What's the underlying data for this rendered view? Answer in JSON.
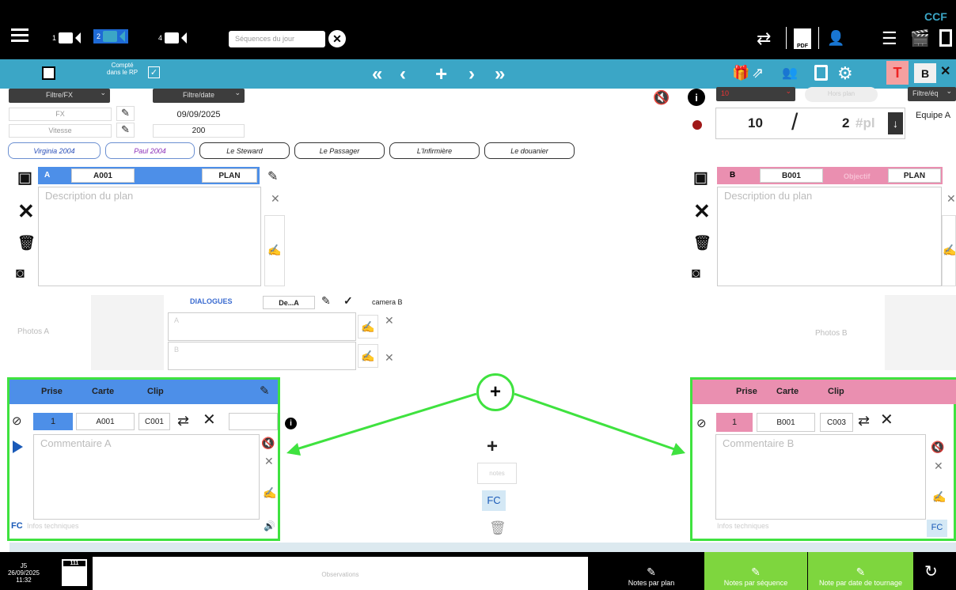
{
  "top": {
    "search_placeholder": "Séquences du jour",
    "brand": "CCF",
    "cams": [
      "1",
      "2",
      "4"
    ]
  },
  "bar": {
    "counted_label_1": "Compté",
    "counted_label_2": "dans le RP"
  },
  "filters": {
    "fx": "Filtre/FX",
    "date": "Filtre/date",
    "fx_input": "FX",
    "date_value": "09/09/2025",
    "speed": "Vitesse",
    "speed_value": "200",
    "sel10": "10",
    "hors_plan": "Hors plan",
    "filtre_eq": "Filtre/éq",
    "equipe": "Equipe A"
  },
  "counter": {
    "seq": "10",
    "slash": "/",
    "num": "2",
    "pl": "#pl"
  },
  "characters": [
    "Virginia 2004",
    "Paul 2004",
    "Le Steward",
    "Le Passager",
    "L'Infirmière",
    "Le douanier"
  ],
  "planA": {
    "cam": "A",
    "code": "A001",
    "type": "PLAN",
    "desc_placeholder": "Description du plan"
  },
  "planB": {
    "cam": "B",
    "code": "B001",
    "objective": "Objectif",
    "type": "PLAN",
    "desc_placeholder": "Description du plan"
  },
  "dialogues": {
    "title": "DIALOGUES",
    "selector": "De...A",
    "camera": "camera B",
    "a": "A",
    "b": "B"
  },
  "photos": {
    "a": "Photos A",
    "b": "Photos B"
  },
  "takeA": {
    "prise": "Prise",
    "carte": "Carte",
    "clip": "Clip",
    "num": "1",
    "card": "A001",
    "clip_val": "C001",
    "comment": "Commentaire A",
    "tech": "Infos techniques",
    "fc": "FC"
  },
  "takeB": {
    "prise": "Prise",
    "carte": "Carte",
    "clip": "Clip",
    "num": "1",
    "card": "B001",
    "clip_val": "C003",
    "comment": "Commentaire B",
    "tech": "Infos techniques",
    "fc": "FC"
  },
  "center": {
    "notes": "notes",
    "fc": "FC"
  },
  "bottom": {
    "day": "J5",
    "date": "26/09/2025",
    "time": "11:32",
    "cal_num": "111",
    "observations": "Observations",
    "notes_plan": "Notes par plan",
    "notes_seq": "Notes par séquence",
    "notes_date": "Note par date de tournage"
  }
}
